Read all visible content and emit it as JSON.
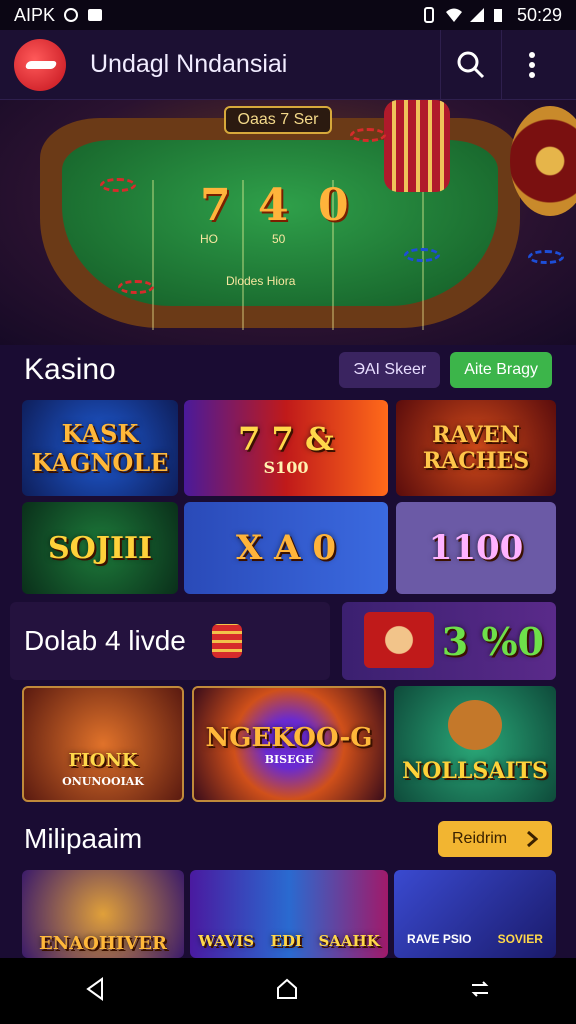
{
  "status_bar": {
    "carrier": "AIPK",
    "time": "50:29"
  },
  "app_bar": {
    "title": "Undagl Nndansiai"
  },
  "hero": {
    "sign": "Oaas 7 Ser",
    "digits": [
      "7",
      "4",
      "0"
    ],
    "felt_text_1": "Dlodes Hiora",
    "felt_text_2": "HO",
    "felt_text_3": "50"
  },
  "kasino": {
    "title": "Kasino",
    "filter_label": "ЭAI Skeer",
    "action_label": "Aite Bragy",
    "action_color": "#3cb54a",
    "tiles": [
      {
        "label": "KASK\nKAGNOLE"
      },
      {
        "label": "7 7 &",
        "sub": "S100"
      },
      {
        "label": "RAVEN\nRACHES"
      },
      {
        "label": "SOJIII"
      },
      {
        "label": "X A 0"
      },
      {
        "label": "1100"
      }
    ]
  },
  "banner": {
    "title": "Dolab 4 livde",
    "prize": "3 %0"
  },
  "featured": {
    "tiles": [
      {
        "label": "FIONK",
        "sub": "ONUNOOIAK"
      },
      {
        "label": "NGEKOO-G",
        "sub": "BISEGE"
      },
      {
        "label": "NOLLSAITS"
      }
    ]
  },
  "multi": {
    "title": "Milipaaim",
    "button_label": "Reidrim",
    "button_color": "#f2b531",
    "tiles": [
      {
        "label": "ENAOHIVER"
      },
      {
        "label": "WAVIS",
        "mid": "EDI",
        "right": "SAAHK"
      },
      {
        "label": "RAVE PSIO",
        "right": "SOVIER"
      }
    ]
  }
}
